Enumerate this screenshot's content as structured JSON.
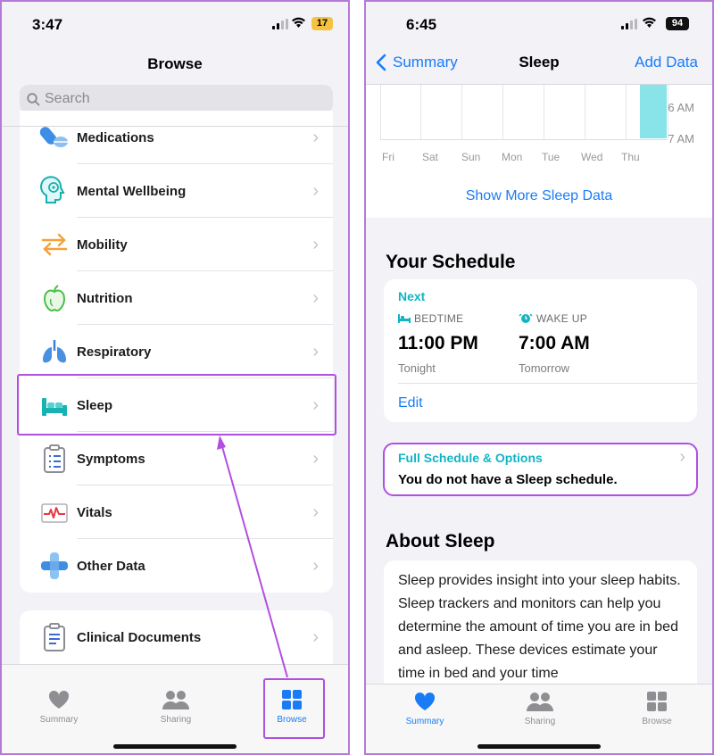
{
  "left": {
    "status": {
      "time": "3:47",
      "battery": "17"
    },
    "header_title": "Browse",
    "search_placeholder": "Search",
    "categories": [
      {
        "label": "Medications",
        "icon": "pills-icon"
      },
      {
        "label": "Mental Wellbeing",
        "icon": "brain-head-icon"
      },
      {
        "label": "Mobility",
        "icon": "mobility-arrows-icon"
      },
      {
        "label": "Nutrition",
        "icon": "apple-icon"
      },
      {
        "label": "Respiratory",
        "icon": "lungs-icon"
      },
      {
        "label": "Sleep",
        "icon": "bed-icon"
      },
      {
        "label": "Symptoms",
        "icon": "clipboard-list-icon"
      },
      {
        "label": "Vitals",
        "icon": "heart-monitor-icon"
      },
      {
        "label": "Other Data",
        "icon": "bandage-plus-icon"
      }
    ],
    "clinical": {
      "label": "Clinical Documents",
      "icon": "document-icon"
    },
    "tabs": [
      {
        "label": "Summary",
        "icon": "heart-icon"
      },
      {
        "label": "Sharing",
        "icon": "people-icon"
      },
      {
        "label": "Browse",
        "icon": "grid-icon"
      }
    ]
  },
  "right": {
    "status": {
      "time": "6:45",
      "battery": "94"
    },
    "nav": {
      "back": "Summary",
      "title": "Sleep",
      "action": "Add Data"
    },
    "chart_labels": {
      "y": [
        "6 AM",
        "7 AM"
      ],
      "days": [
        "Fri",
        "Sat",
        "Sun",
        "Mon",
        "Tue",
        "Wed",
        "Thu"
      ]
    },
    "show_more": "Show More Sleep Data",
    "schedule_heading": "Your Schedule",
    "schedule": {
      "next_label": "Next",
      "bedtime_label": "BEDTIME",
      "bedtime_time": "11:00 PM",
      "bedtime_day": "Tonight",
      "wake_label": "WAKE UP",
      "wake_time": "7:00 AM",
      "wake_day": "Tomorrow",
      "edit": "Edit"
    },
    "full_schedule": {
      "title": "Full Schedule & Options",
      "message": "You do not have a Sleep schedule."
    },
    "about_heading": "About Sleep",
    "about_text": "Sleep provides insight into your sleep habits. Sleep trackers and monitors can help you determine the amount of time you are in bed and asleep. These devices estimate your time in bed and your time",
    "tabs": [
      {
        "label": "Summary",
        "icon": "heart-icon"
      },
      {
        "label": "Sharing",
        "icon": "people-icon"
      },
      {
        "label": "Browse",
        "icon": "grid-icon"
      }
    ]
  },
  "colors": {
    "accent": "#1a7cf5",
    "highlight": "#b14fe0",
    "teal": "#12b4c4"
  }
}
